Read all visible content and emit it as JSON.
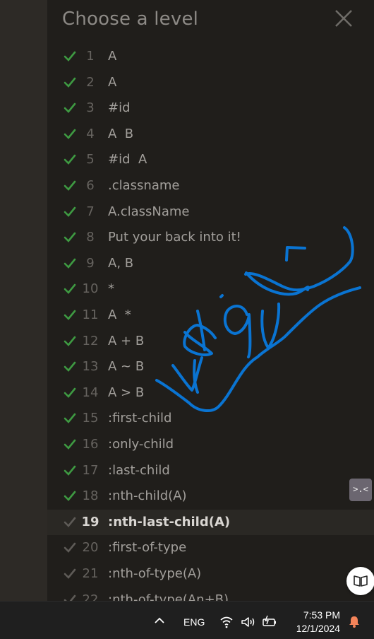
{
  "panel": {
    "title": "Choose a level",
    "levels": [
      {
        "num": "1",
        "name": "A",
        "completed": true
      },
      {
        "num": "2",
        "name": "A",
        "completed": true
      },
      {
        "num": "3",
        "name": "#id",
        "completed": true
      },
      {
        "num": "4",
        "name": "A  B",
        "completed": true
      },
      {
        "num": "5",
        "name": "#id  A",
        "completed": true
      },
      {
        "num": "6",
        "name": ".classname",
        "completed": true
      },
      {
        "num": "7",
        "name": "A.className",
        "completed": true
      },
      {
        "num": "8",
        "name": "Put your back into it!",
        "completed": true
      },
      {
        "num": "9",
        "name": "A, B",
        "completed": true
      },
      {
        "num": "10",
        "name": "*",
        "completed": true
      },
      {
        "num": "11",
        "name": "A  *",
        "completed": true
      },
      {
        "num": "12",
        "name": "A + B",
        "completed": true
      },
      {
        "num": "13",
        "name": "A ~ B",
        "completed": true
      },
      {
        "num": "14",
        "name": "A > B",
        "completed": true
      },
      {
        "num": "15",
        "name": ":first-child",
        "completed": true
      },
      {
        "num": "16",
        "name": ":only-child",
        "completed": true
      },
      {
        "num": "17",
        "name": ":last-child",
        "completed": true
      },
      {
        "num": "18",
        "name": ":nth-child(A)",
        "completed": true
      },
      {
        "num": "19",
        "name": ":nth-last-child(A)",
        "completed": false,
        "active": true
      },
      {
        "num": "20",
        "name": ":first-of-type",
        "completed": false
      },
      {
        "num": "21",
        "name": ":nth-of-type(A)",
        "completed": false
      },
      {
        "num": "22",
        "name": ":nth-of-type(An+B)",
        "completed": false
      }
    ]
  },
  "colors": {
    "check_done": "#3e9a42",
    "check_pending": "#5e5b57",
    "ink": "#0a74d2"
  },
  "floating": {
    "emoji_button_label": ">.<"
  },
  "taskbar": {
    "language": "ENG",
    "time": "7:53 PM",
    "date": "12/1/2024"
  }
}
